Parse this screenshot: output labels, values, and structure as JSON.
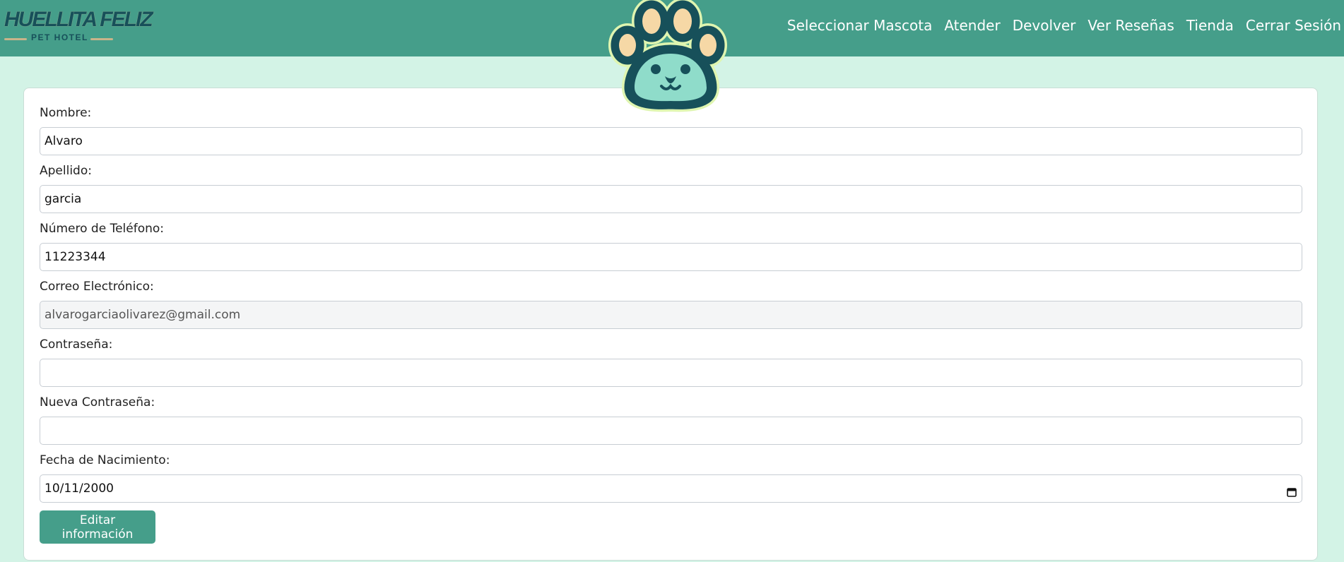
{
  "brand": {
    "name": "HUELLITA FELIZ",
    "subtitle": "PET HOTEL"
  },
  "colors": {
    "accent": "#459e8a",
    "page_background": "#d3f3e6",
    "logo_text": "#17505a"
  },
  "nav": {
    "items": [
      {
        "label": "Seleccionar Mascota"
      },
      {
        "label": "Atender"
      },
      {
        "label": "Devolver"
      },
      {
        "label": "Ver Reseñas"
      },
      {
        "label": "Tienda"
      },
      {
        "label": "Cerrar Sesión"
      }
    ]
  },
  "mascot": {
    "icon": "paw-icon"
  },
  "form": {
    "nombre": {
      "label": "Nombre:",
      "value": "Alvaro"
    },
    "apellido": {
      "label": "Apellido:",
      "value": "garcia"
    },
    "telefono": {
      "label": "Número de Teléfono:",
      "value": "11223344"
    },
    "correo": {
      "label": "Correo Electrónico:",
      "value": "alvarogarciaolivarez@gmail.com"
    },
    "contrasena": {
      "label": "Contraseña:",
      "value": ""
    },
    "nueva_contrasena": {
      "label": "Nueva Contraseña:",
      "value": ""
    },
    "fecha": {
      "label": "Fecha de Nacimiento:",
      "value": "10/11/2000",
      "icon": "calendar-icon"
    },
    "submit_label": "Editar información"
  }
}
